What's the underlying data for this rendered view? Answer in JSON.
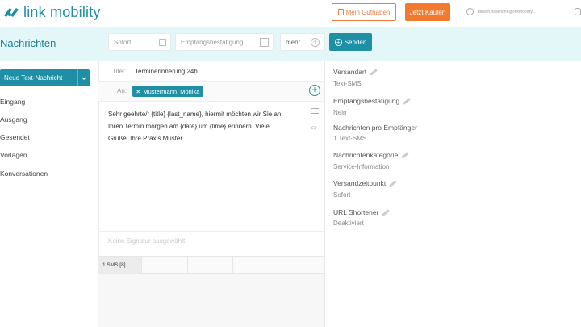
{
  "brand": {
    "logo_text": "link mobility",
    "color": "#1f8fa6"
  },
  "topbar": {
    "guthaben_label": "Mein Guthaben",
    "kaufen_label": "Jetzt Kaufen",
    "user_email": "miriam.hasenohrl@linkmobility..."
  },
  "header": {
    "title": "Nachrichten",
    "sofort_placeholder": "Sofort",
    "empfang_placeholder": "Empfangsbestätigung",
    "mehr_label": "mehr",
    "senden_label": "Senden"
  },
  "sidebar": {
    "new_button": "Neue Text-Nachricht",
    "items": [
      {
        "label": "Eingang"
      },
      {
        "label": "Ausgang"
      },
      {
        "label": "Gesendet"
      },
      {
        "label": "Vorlagen"
      },
      {
        "label": "Konversationen"
      }
    ]
  },
  "compose": {
    "title_label": "Titel:",
    "title_value": "Terminerinnerung 24h",
    "to_label": "An:",
    "recipient": "Mustermann, Monika",
    "message": "Sehr geehrte/r {title} {last_name}, hiermit möchten wir Sie an Ihren Termin morgen am {date} um {time} erinnern. Viele Grüße, Ihre Praxis Muster",
    "signature_placeholder": "Keine Signatur ausgewählt",
    "sms_count": "1 SMS [8]"
  },
  "settings": [
    {
      "label": "Versandart",
      "value": "Text-SMS"
    },
    {
      "label": "Empfangsbestätigung",
      "value": "Nein"
    },
    {
      "label": "Nachrichten pro Empfänger",
      "value": "1 Text-SMS"
    },
    {
      "label": "Nachrichtenkategorie",
      "value": "Service-Information"
    },
    {
      "label": "Versandzeitpunkt",
      "value": "Sofort"
    },
    {
      "label": "URL Shortener",
      "value": "Deaktiviert"
    }
  ]
}
